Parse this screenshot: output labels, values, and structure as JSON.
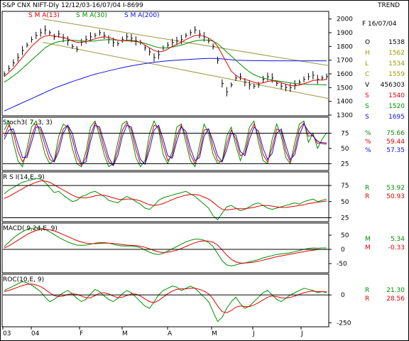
{
  "header": {
    "title": "S&P CNX NIFT-Dly  12/12/03-16/07/04  I-8699",
    "mode": "TREND",
    "date_label": "F 16/07/04"
  },
  "colors": {
    "price": "#000000",
    "sma13": "#e00000",
    "sma30": "#009000",
    "sma200": "#1010e0",
    "channel": "#9a9a40",
    "label_gray": "#606060"
  },
  "ohlc_panel": {
    "rows": [
      {
        "key": "O",
        "value": "1538",
        "color": "#000000"
      },
      {
        "key": "H",
        "value": "1562",
        "color": "#9a9a00"
      },
      {
        "key": "L",
        "value": "1534",
        "color": "#9a9a00"
      },
      {
        "key": "C",
        "value": "1559",
        "color": "#9a9a00"
      },
      {
        "key": "V",
        "value": "456303",
        "color": "#000000"
      },
      {
        "key": "S",
        "value": "1540",
        "color": "#e00000"
      },
      {
        "key": "S",
        "value": "1520",
        "color": "#009000"
      },
      {
        "key": "S",
        "value": "1695",
        "color": "#1010e0"
      }
    ]
  },
  "indicator_values": {
    "stoch": [
      {
        "key": "%",
        "value": "75.66",
        "color": "#009000"
      },
      {
        "key": "%",
        "value": "59.44",
        "color": "#e00000"
      },
      {
        "key": "%",
        "value": "57.35",
        "color": "#1010e0"
      }
    ],
    "rsi": [
      {
        "key": "R",
        "value": "53.92",
        "color": "#009000"
      },
      {
        "key": "R",
        "value": "50.93",
        "color": "#e00000"
      }
    ],
    "macd": [
      {
        "key": "M",
        "value": "5.34",
        "color": "#009000"
      },
      {
        "key": "M",
        "value": "-0.33",
        "color": "#e00000"
      }
    ],
    "roc": [
      {
        "key": "R",
        "value": "21.30",
        "color": "#009000"
      },
      {
        "key": "R",
        "value": "28.56",
        "color": "#e00000"
      }
    ]
  },
  "x_axis": {
    "labels": [
      "03",
      "04",
      "F",
      "M",
      "A",
      "M",
      "J",
      "J"
    ]
  },
  "chart_data": [
    {
      "type": "line",
      "title": "S&P CNX NIFT-Dly 12/12/03-16/07/04",
      "legend": [
        "S M A(13)",
        "S M A(30)",
        "S M A(200)"
      ],
      "ylim": [
        1300,
        2050
      ],
      "yticks": [
        2000,
        1900,
        1800,
        1700,
        1600,
        1500,
        1400,
        1300
      ],
      "price": [
        1600,
        1640,
        1680,
        1720,
        1770,
        1810,
        1850,
        1880,
        1900,
        1920,
        1900,
        1870,
        1890,
        1860,
        1840,
        1800,
        1780,
        1830,
        1850,
        1870,
        1880,
        1900,
        1880,
        1850,
        1830,
        1820,
        1850,
        1870,
        1860,
        1840,
        1830,
        1790,
        1760,
        1720,
        1740,
        1790,
        1810,
        1830,
        1840,
        1850,
        1880,
        1900,
        1920,
        1890,
        1870,
        1840,
        1800,
        1700,
        1530,
        1470,
        1520,
        1570,
        1580,
        1540,
        1520,
        1510,
        1520,
        1560,
        1580,
        1570,
        1530,
        1510,
        1500,
        1500,
        1520,
        1540,
        1560,
        1580,
        1590,
        1560,
        1570,
        1580
      ],
      "sma13": [
        1580,
        1610,
        1640,
        1680,
        1720,
        1760,
        1800,
        1830,
        1860,
        1875,
        1880,
        1875,
        1870,
        1865,
        1855,
        1840,
        1830,
        1830,
        1835,
        1845,
        1855,
        1865,
        1870,
        1865,
        1855,
        1845,
        1840,
        1845,
        1845,
        1840,
        1830,
        1810,
        1790,
        1770,
        1760,
        1765,
        1780,
        1800,
        1815,
        1830,
        1850,
        1865,
        1880,
        1880,
        1875,
        1860,
        1840,
        1800,
        1740,
        1680,
        1620,
        1590,
        1570,
        1560,
        1550,
        1540,
        1530,
        1535,
        1545,
        1550,
        1545,
        1535,
        1525,
        1515,
        1512,
        1518,
        1528,
        1540,
        1552,
        1555,
        1556,
        1560
      ],
      "sma30": [
        1540,
        1560,
        1585,
        1610,
        1640,
        1670,
        1700,
        1730,
        1760,
        1790,
        1810,
        1825,
        1835,
        1840,
        1845,
        1845,
        1843,
        1840,
        1838,
        1838,
        1840,
        1845,
        1848,
        1850,
        1848,
        1845,
        1842,
        1840,
        1838,
        1835,
        1830,
        1822,
        1812,
        1800,
        1792,
        1788,
        1790,
        1795,
        1802,
        1810,
        1820,
        1830,
        1840,
        1845,
        1847,
        1845,
        1838,
        1820,
        1790,
        1760,
        1730,
        1700,
        1670,
        1640,
        1615,
        1595,
        1580,
        1570,
        1562,
        1555,
        1550,
        1545,
        1540,
        1535,
        1530,
        1527,
        1525,
        1524,
        1523,
        1522,
        1521,
        1520
      ],
      "sma200": [
        1330,
        1345,
        1360,
        1375,
        1390,
        1405,
        1420,
        1435,
        1450,
        1465,
        1480,
        1495,
        1508,
        1520,
        1532,
        1544,
        1555,
        1566,
        1577,
        1588,
        1598,
        1606,
        1614,
        1622,
        1630,
        1638,
        1645,
        1652,
        1658,
        1664,
        1670,
        1675,
        1680,
        1684,
        1688,
        1692,
        1695,
        1698,
        1700,
        1702,
        1704,
        1706,
        1708,
        1710,
        1711,
        1712,
        1712,
        1711,
        1709,
        1706,
        1703,
        1700,
        1699,
        1698,
        1697,
        1696,
        1696,
        1696,
        1695,
        1695,
        1695,
        1695,
        1695,
        1695,
        1695,
        1695,
        1695,
        1695,
        1695,
        1695,
        1695,
        1695
      ]
    },
    {
      "type": "line",
      "title": "Stoch3( 7, 3, 3)",
      "ylim": [
        15,
        100
      ],
      "yticks": [
        75,
        50,
        25
      ],
      "series": [
        {
          "name": "%K",
          "color": "#009000",
          "values": [
            80,
            95,
            60,
            30,
            20,
            50,
            85,
            95,
            70,
            40,
            25,
            30,
            70,
            90,
            85,
            50,
            25,
            20,
            45,
            85,
            95,
            70,
            40,
            20,
            25,
            60,
            90,
            95,
            70,
            35,
            20,
            30,
            75,
            95,
            80,
            40,
            25,
            45,
            85,
            90,
            60,
            30,
            20,
            55,
            90,
            75,
            40,
            25,
            30,
            70,
            85,
            55,
            30,
            50,
            85,
            95,
            60,
            30,
            25,
            65,
            90,
            70,
            35,
            25,
            60,
            90,
            95,
            60,
            75,
            50,
            65,
            76
          ]
        },
        {
          "name": "%D",
          "color": "#e00000",
          "values": [
            70,
            88,
            75,
            45,
            28,
            40,
            70,
            90,
            80,
            55,
            32,
            28,
            55,
            82,
            88,
            65,
            35,
            22,
            35,
            72,
            92,
            80,
            50,
            28,
            22,
            48,
            80,
            92,
            80,
            48,
            25,
            25,
            60,
            88,
            85,
            55,
            30,
            38,
            72,
            88,
            70,
            40,
            25,
            42,
            80,
            82,
            52,
            30,
            28,
            58,
            80,
            65,
            38,
            42,
            75,
            90,
            70,
            40,
            28,
            52,
            82,
            78,
            45,
            28,
            48,
            82,
            92,
            70,
            72,
            58,
            60,
            59
          ]
        },
        {
          "name": "%D slow",
          "color": "#1010e0",
          "values": [
            65,
            80,
            82,
            58,
            35,
            35,
            60,
            85,
            85,
            65,
            42,
            28,
            45,
            75,
            88,
            75,
            45,
            25,
            28,
            62,
            88,
            85,
            60,
            35,
            22,
            38,
            70,
            88,
            85,
            58,
            32,
            24,
            48,
            80,
            88,
            65,
            38,
            34,
            62,
            85,
            78,
            50,
            30,
            35,
            70,
            82,
            62,
            38,
            28,
            48,
            75,
            72,
            45,
            38,
            65,
            85,
            78,
            50,
            32,
            42,
            75,
            82,
            55,
            32,
            40,
            72,
            90,
            78,
            70,
            62,
            58,
            57
          ]
        }
      ]
    },
    {
      "type": "line",
      "title": "R S I(14,E, 9)",
      "ylim": [
        20,
        95
      ],
      "yticks": [
        75,
        50,
        25
      ],
      "series": [
        {
          "name": "RSI",
          "color": "#009000",
          "values": [
            62,
            68,
            72,
            76,
            80,
            82,
            84,
            86,
            85,
            80,
            72,
            64,
            66,
            60,
            55,
            50,
            52,
            58,
            60,
            64,
            66,
            62,
            58,
            52,
            50,
            48,
            54,
            58,
            55,
            50,
            46,
            40,
            38,
            44,
            52,
            56,
            58,
            60,
            62,
            64,
            66,
            62,
            58,
            52,
            46,
            40,
            28,
            22,
            32,
            42,
            44,
            40,
            36,
            38,
            42,
            46,
            48,
            44,
            40,
            38,
            40,
            42,
            44,
            46,
            48,
            46,
            50,
            52,
            54,
            50,
            52,
            54
          ]
        },
        {
          "name": "Avg",
          "color": "#e00000",
          "values": [
            55,
            58,
            62,
            66,
            70,
            74,
            77,
            80,
            82,
            82,
            80,
            76,
            72,
            68,
            64,
            60,
            57,
            56,
            56,
            57,
            59,
            60,
            60,
            58,
            56,
            54,
            53,
            54,
            54,
            53,
            51,
            48,
            45,
            44,
            45,
            47,
            50,
            53,
            56,
            58,
            60,
            61,
            61,
            60,
            57,
            54,
            49,
            43,
            38,
            37,
            38,
            39,
            39,
            39,
            40,
            41,
            43,
            44,
            44,
            43,
            42,
            41,
            41,
            42,
            43,
            44,
            45,
            47,
            48,
            49,
            50,
            51
          ]
        }
      ]
    },
    {
      "type": "line",
      "title": "MACD( 9,24,E, 9)",
      "ylim": [
        -80,
        90
      ],
      "yticks": [
        50,
        0,
        -50
      ],
      "series": [
        {
          "name": "MACD",
          "color": "#009000",
          "values": [
            10,
            25,
            40,
            52,
            62,
            70,
            74,
            76,
            75,
            70,
            62,
            52,
            42,
            34,
            26,
            20,
            15,
            14,
            15,
            18,
            22,
            24,
            24,
            22,
            18,
            14,
            12,
            12,
            12,
            10,
            6,
            -2,
            -10,
            -16,
            -18,
            -14,
            -6,
            2,
            10,
            18,
            26,
            32,
            36,
            36,
            32,
            24,
            10,
            -15,
            -40,
            -55,
            -58,
            -55,
            -50,
            -48,
            -44,
            -40,
            -36,
            -30,
            -26,
            -22,
            -18,
            -16,
            -14,
            -12,
            -8,
            -4,
            0,
            3,
            5,
            4,
            5,
            5
          ]
        },
        {
          "name": "Signal",
          "color": "#e00000",
          "values": [
            5,
            12,
            22,
            32,
            42,
            52,
            60,
            66,
            70,
            71,
            69,
            65,
            59,
            52,
            45,
            38,
            31,
            26,
            22,
            20,
            20,
            21,
            22,
            22,
            21,
            19,
            17,
            15,
            14,
            13,
            11,
            7,
            2,
            -4,
            -9,
            -11,
            -10,
            -7,
            -3,
            3,
            10,
            17,
            23,
            28,
            30,
            29,
            25,
            15,
            -2,
            -20,
            -35,
            -44,
            -48,
            -48,
            -47,
            -45,
            -42,
            -38,
            -34,
            -30,
            -26,
            -23,
            -20,
            -17,
            -14,
            -11,
            -8,
            -5,
            -3,
            -1,
            0,
            -0.33
          ]
        }
      ]
    },
    {
      "type": "line",
      "title": "ROC(10,E, 9)",
      "ylim": [
        -280,
        180
      ],
      "yticks": [
        0,
        -250
      ],
      "series": [
        {
          "name": "ROC",
          "color": "#009000",
          "values": [
            40,
            60,
            80,
            100,
            120,
            110,
            90,
            60,
            30,
            -20,
            -60,
            -40,
            -10,
            20,
            40,
            10,
            -30,
            -60,
            -40,
            10,
            50,
            30,
            -10,
            -40,
            -60,
            -30,
            10,
            40,
            20,
            -20,
            -60,
            -100,
            -120,
            -60,
            0,
            40,
            60,
            80,
            70,
            40,
            60,
            80,
            60,
            20,
            -20,
            -60,
            -150,
            -240,
            -200,
            -120,
            -60,
            -20,
            -80,
            -120,
            -100,
            -60,
            -20,
            20,
            40,
            0,
            -40,
            -60,
            -30,
            0,
            20,
            40,
            60,
            50,
            40,
            20,
            30,
            21
          ]
        },
        {
          "name": "Avg",
          "color": "#e00000",
          "values": [
            30,
            40,
            55,
            70,
            85,
            95,
            98,
            90,
            75,
            50,
            20,
            -5,
            -15,
            -10,
            5,
            10,
            5,
            -10,
            -25,
            -25,
            -5,
            15,
            20,
            10,
            -10,
            -25,
            -20,
            -5,
            10,
            8,
            -10,
            -35,
            -60,
            -70,
            -50,
            -20,
            10,
            35,
            50,
            55,
            55,
            60,
            60,
            50,
            35,
            10,
            -35,
            -100,
            -150,
            -160,
            -140,
            -110,
            -100,
            -105,
            -105,
            -90,
            -70,
            -45,
            -20,
            -10,
            -15,
            -25,
            -28,
            -22,
            -10,
            5,
            20,
            30,
            35,
            30,
            30,
            28.56
          ]
        }
      ]
    }
  ]
}
